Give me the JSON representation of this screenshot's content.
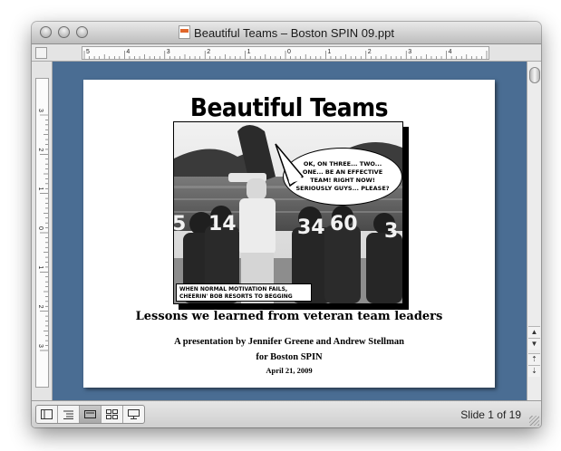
{
  "window": {
    "title": "Beautiful Teams – Boston SPIN 09.ppt"
  },
  "ruler": {
    "h_labels": [
      "5",
      "4",
      "3",
      "2",
      "1",
      "0",
      "1",
      "2",
      "3",
      "4",
      "5"
    ],
    "v_labels": [
      "3",
      "2",
      "1",
      "0",
      "1",
      "2",
      "3"
    ]
  },
  "slide": {
    "title": "Beautiful Teams",
    "speech_bubble": "OK, ON THREE... TWO... ONE... BE AN EFFECTIVE TEAM! RIGHT NOW! SERIOUSLY GUYS... PLEASE?",
    "caption": "WHEN NORMAL MOTIVATION FAILS, CHEERIN' BOB RESORTS TO BEGGING",
    "jersey_numbers": [
      "5",
      "14",
      "34",
      "60",
      "3"
    ],
    "subtitle": "Lessons we learned from veteran team leaders",
    "byline": "A presentation by Jennifer Greene and Andrew Stellman",
    "for_line": "for Boston SPIN",
    "date": "April 21, 2009"
  },
  "statusbar": {
    "slide_count": "Slide 1 of 19",
    "view_buttons": [
      "normal-view-icon",
      "outline-view-icon",
      "slide-view-icon",
      "slide-sorter-icon",
      "slideshow-icon"
    ]
  }
}
